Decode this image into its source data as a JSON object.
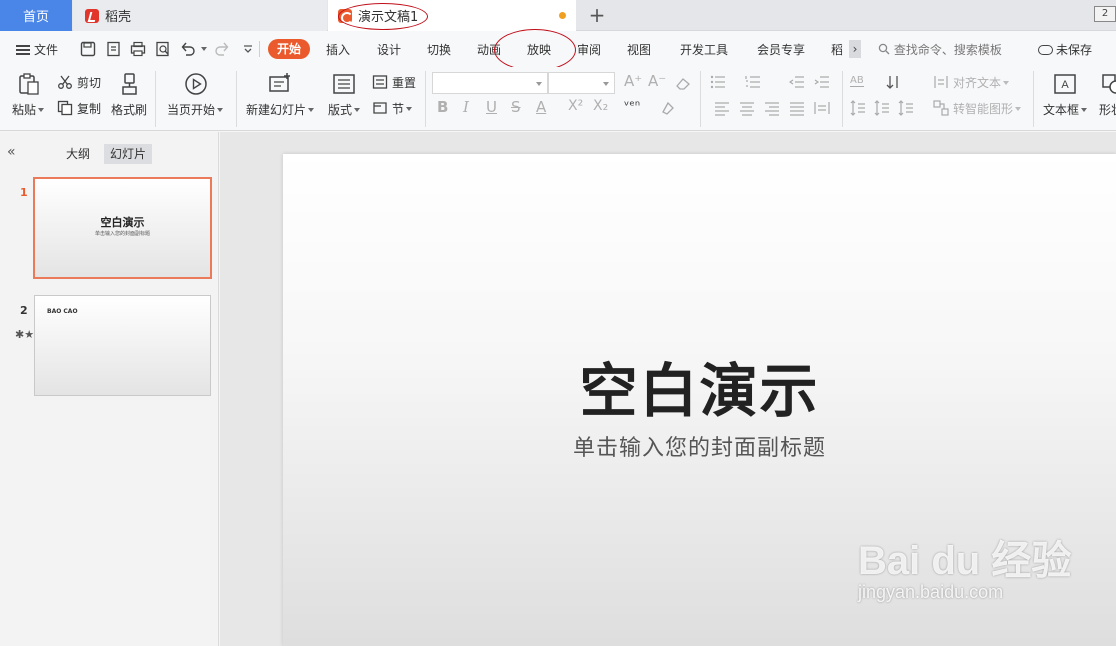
{
  "tabs": {
    "home": "首页",
    "daoke": "稻壳",
    "doc": "演示文稿1",
    "plus": "+",
    "corner": "2"
  },
  "menu": {
    "file": "文件",
    "items": [
      "开始",
      "插入",
      "设计",
      "切换",
      "动画",
      "放映",
      "审阅",
      "视图",
      "开发工具",
      "会员专享",
      "稻"
    ],
    "search": "查找命令、搜索模板",
    "save_status": "未保存"
  },
  "ribbon": {
    "paste": "粘贴",
    "cut": "剪切",
    "copy": "复制",
    "format_painter": "格式刷",
    "play_current": "当页开始",
    "new_slide": "新建幻灯片",
    "layout": "版式",
    "reset": "重置",
    "section": "节",
    "align_text": "对齐文本",
    "smart_shape": "转智能图形",
    "text_box": "文本框",
    "shape": "形状"
  },
  "leftpanel": {
    "outline": "大纲",
    "slides": "幻灯片",
    "thumbs": [
      {
        "num": "1",
        "title": "空白演示",
        "sub": "单击输入您的封面副标题"
      },
      {
        "num": "2",
        "title": "BAO CAO"
      }
    ]
  },
  "slide": {
    "title": "空白演示",
    "subtitle": "单击输入您的封面副标题"
  },
  "watermark": {
    "logo": "Bai du 经验",
    "url": "jingyan.baidu.com"
  },
  "colors": {
    "accent": "#ea5a2c",
    "home_tab": "#4a86e8",
    "annotation": "#c0101a"
  }
}
